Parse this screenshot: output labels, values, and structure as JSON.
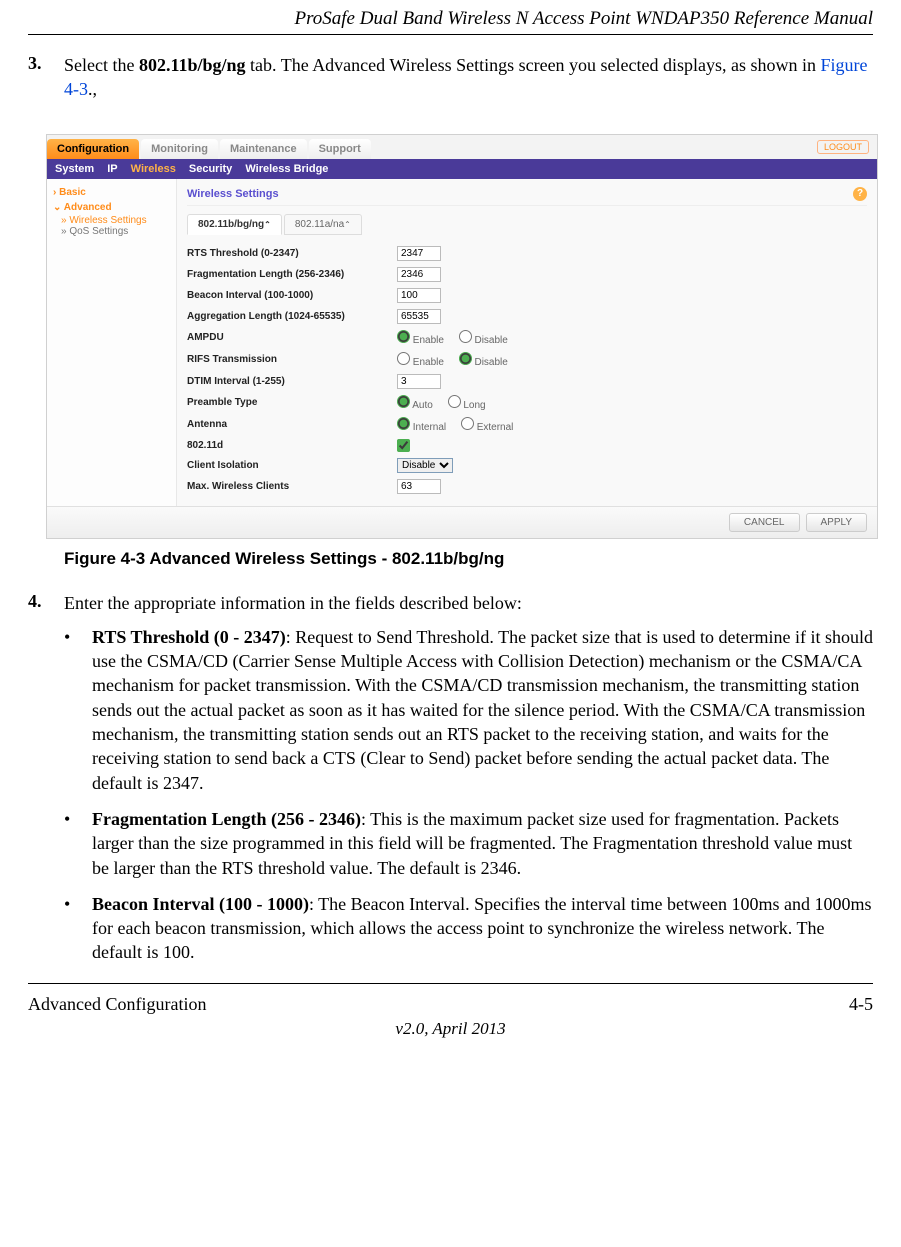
{
  "doc": {
    "header_title": "ProSafe Dual Band Wireless N Access Point WNDAP350 Reference Manual",
    "footer_left": "Advanced Configuration",
    "footer_right": "4-5",
    "version": "v2.0, April 2013",
    "figure_caption": "Figure 4-3  Advanced Wireless Settings - 802.11b/bg/ng"
  },
  "step3": {
    "num": "3.",
    "pre": "Select the ",
    "bold": "802.11b/bg/ng",
    "mid": " tab. The Advanced Wireless Settings screen you selected displays, as shown in ",
    "link": "Figure 4-3",
    "post": ".,"
  },
  "step4": {
    "num": "4.",
    "text": "Enter the appropriate information in the fields described below:"
  },
  "b1": {
    "title": "RTS Threshold (0 - 2347)",
    "text": ": Request to Send Threshold. The packet size that is used to determine if it should use the CSMA/CD (Carrier Sense Multiple Access with Collision Detection) mechanism or the CSMA/CA mechanism for packet transmission. With the CSMA/CD transmission mechanism, the transmitting station sends out the actual packet as soon as it has waited for the silence period. With the CSMA/CA transmission mechanism, the transmitting station sends out an RTS packet to the receiving station, and waits for the receiving station to send back a CTS (Clear to Send) packet before sending the actual packet data. The default is 2347."
  },
  "b2": {
    "title": "Fragmentation Length (256 - 2346)",
    "text": ": This is the maximum packet size used for fragmentation. Packets larger than the size programmed in this field will be fragmented. The Fragmentation threshold value must be larger than the RTS threshold value. The default is 2346."
  },
  "b3": {
    "title": "Beacon Interval (100 - 1000)",
    "text": ": The Beacon Interval. Specifies the interval time between 100ms and 1000ms for each beacon transmission, which allows the access point to synchronize the wireless network. The default is 100."
  },
  "ui": {
    "top": {
      "t1": "Configuration",
      "t2": "Monitoring",
      "t3": "Maintenance",
      "t4": "Support",
      "logout": "LOGOUT"
    },
    "sub": {
      "s1": "System",
      "s2": "IP",
      "s3": "Wireless",
      "s4": "Security",
      "s5": "Wireless Bridge"
    },
    "nav": {
      "n1": "Basic",
      "n2": "Advanced",
      "n3": "Wireless Settings",
      "n4": "QoS Settings"
    },
    "panel_title": "Wireless Settings",
    "band": {
      "b1": "802.11b/bg/ng",
      "b2": "802.11a/na"
    },
    "rows": {
      "rts": {
        "label": "RTS Threshold (0-2347)",
        "val": "2347"
      },
      "frag": {
        "label": "Fragmentation Length (256-2346)",
        "val": "2346"
      },
      "beacon": {
        "label": "Beacon Interval (100-1000)",
        "val": "100"
      },
      "agg": {
        "label": "Aggregation Length (1024-65535)",
        "val": "65535"
      },
      "ampdu": {
        "label": "AMPDU",
        "o1": "Enable",
        "o2": "Disable"
      },
      "rifs": {
        "label": "RIFS Transmission",
        "o1": "Enable",
        "o2": "Disable"
      },
      "dtim": {
        "label": "DTIM Interval (1-255)",
        "val": "3"
      },
      "preamble": {
        "label": "Preamble Type",
        "o1": "Auto",
        "o2": "Long"
      },
      "antenna": {
        "label": "Antenna",
        "o1": "Internal",
        "o2": "External"
      },
      "d11": {
        "label": "802.11d"
      },
      "iso": {
        "label": "Client Isolation",
        "val": "Disable"
      },
      "max": {
        "label": "Max. Wireless Clients",
        "val": "63"
      }
    },
    "btn": {
      "cancel": "CANCEL",
      "apply": "APPLY"
    },
    "help": "?"
  }
}
